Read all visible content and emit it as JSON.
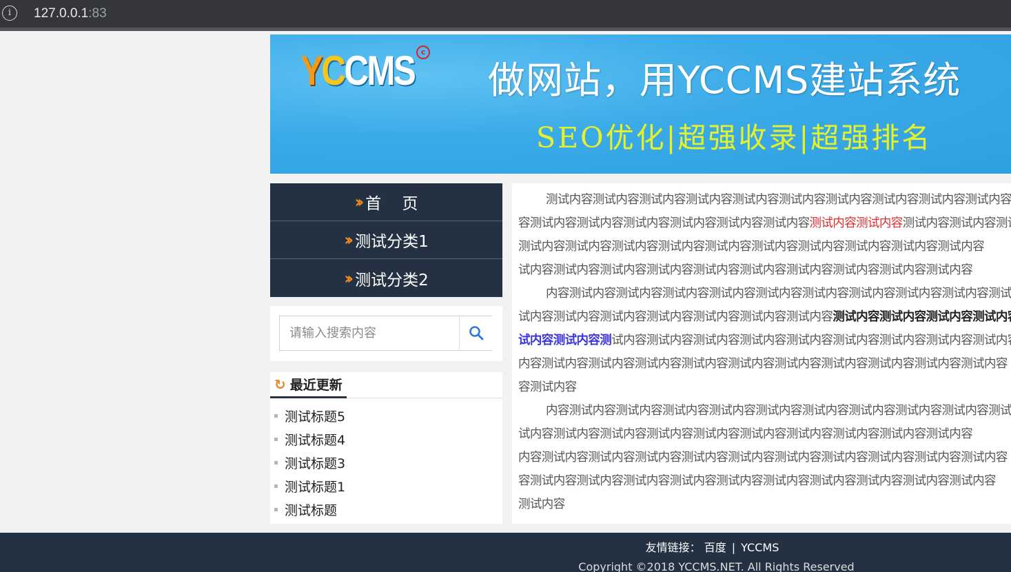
{
  "browser": {
    "url_host": "127.0.0.1",
    "url_port": ":83"
  },
  "banner": {
    "logo_y": "Y",
    "logo_c": "C",
    "logo_rest": "CMS",
    "copyright_mark": "c",
    "headline": "做网站，用YCCMS建站系统",
    "tagline": "SEO优化|超强收录|超强排名"
  },
  "nav": {
    "items": [
      {
        "label": "首 　页"
      },
      {
        "label": "测试分类1"
      },
      {
        "label": "测试分类2"
      }
    ]
  },
  "search": {
    "placeholder": "请输入搜索内容"
  },
  "recent": {
    "title": "最近更新",
    "items": [
      "测试标题5",
      "测试标题4",
      "测试标题3",
      "测试标题1",
      "测试标题"
    ]
  },
  "content": {
    "p1_line1": "测试内容测试内容测试内容测试内容测试内容测试内容测试内容测试内容测试内容测试内容",
    "p1_line2_a": "容测试内容测试内容测试内容测试内容测试内容测试内容",
    "p1_line2_red": "测试内容测试内容",
    "p1_line2_b": "测试内容测试内容测试内容测试内容",
    "p1_line3": "测试内容测试内容测试内容测试内容测试内容测试内容测试内容测试内容测试内容测试内容",
    "p1_line4": "试内容测试内容测试内容测试内容测试内容测试内容测试内容测试内容测试内容测试内容",
    "p2_line1": "内容测试内容测试内容测试内容测试内容测试内容测试内容测试内容测试内容测试内容测试内容",
    "p2_line2_a": "试内容测试内容测试内容测试内容测试内容测试内容测试内容",
    "p2_line2_bold": "测试内容测试内容测试内容测试内容",
    "p2_line3_blue": "试内容测试内容测",
    "p2_line3_b": "试内容测试内容测试内容测试内容测试内容测试内容测试内容测试内容测试内容",
    "p2_line4": "内容测试内容测试内容测试内容测试内容测试内容测试内容测试内容测试内容测试内容测试内容",
    "p2_line5": "容测试内容",
    "p3_line1": "内容测试内容测试内容测试内容测试内容测试内容测试内容测试内容测试内容测试内容测试内容",
    "p3_line2": "试内容测试内容测试内容测试内容测试内容测试内容测试内容测试内容测试内容测试内容",
    "p3_line3": "内容测试内容测试内容测试内容测试内容测试内容测试内容测试内容测试内容测试内容测试内容",
    "p3_line4": "容测试内容测试内容测试内容测试内容测试内容测试内容测试内容测试内容测试内容测试内容",
    "p3_line5": "测试内容"
  },
  "footer": {
    "links_label": "友情链接：",
    "links": [
      "百度",
      "YCCMS"
    ],
    "separator": "|",
    "copyright": "Copyright ©2018 YCCMS.NET. All Rights Reserved"
  },
  "colors": {
    "nav_bg": "#243142",
    "accent_orange": "#f08a1e",
    "banner_blue": "#3aaae8",
    "highlight_red": "#e2292f",
    "highlight_blue": "#3b35e0"
  }
}
